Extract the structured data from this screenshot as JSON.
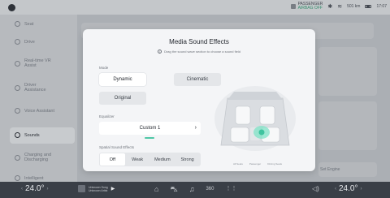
{
  "status": {
    "passenger_title": "PASSENGER",
    "passenger_sub": "AIRBAG OFF",
    "range": "501 km",
    "time": "17:07",
    "icons": [
      "bluetooth-icon",
      "wifi-icon",
      "battery-icon"
    ]
  },
  "sidebar": {
    "items": [
      {
        "label": "Seat",
        "icon": "seat-icon"
      },
      {
        "label": "Drive",
        "icon": "steering-icon"
      },
      {
        "label": "Real-time VR Assist",
        "icon": "vr-icon"
      },
      {
        "label": "Driver Assistance",
        "icon": "assist-icon"
      },
      {
        "label": "Voice Assistant",
        "icon": "voice-icon"
      },
      {
        "label": "Sounds",
        "icon": "sound-icon"
      },
      {
        "label": "Charging and Discharging",
        "icon": "charging-icon"
      },
      {
        "label": "Intelligent",
        "icon": "intelligent-icon"
      }
    ],
    "active_index": 5
  },
  "modal": {
    "title": "Media Sound Effects",
    "subtitle": "Drag the sound wave section to choose a sound field",
    "mode_label": "Mode",
    "modes": [
      "Dynamic",
      "Cinematic",
      "Original"
    ],
    "mode_selected": "Dynamic",
    "equalizer_label": "Equalizer",
    "equalizer_value": "Custom 1",
    "spatial_label": "Spatial Sound Effects",
    "spatial_options": [
      "Off",
      "Weak",
      "Medium",
      "Strong"
    ],
    "spatial_selected": "Off",
    "legend": [
      "All Seats",
      "Passenger",
      "Driving Seats"
    ]
  },
  "background": {
    "right_label": "Set Engine"
  },
  "bottom": {
    "temp_left": "24.0°",
    "temp_right": "24.0°",
    "music_title": "Unknown Song",
    "music_artist": "Unknown Artist",
    "dock": [
      "home-icon",
      "car-icon",
      "music-icon",
      "360-icon",
      "apps-icon"
    ],
    "dock_labels": [
      "⌂",
      "⛍",
      "♫",
      "360",
      "⋮⋮"
    ]
  },
  "colors": {
    "accent": "#4fc7a6",
    "modal_bg": "#f4f5f7",
    "bottom_bg": "#3a3f47"
  }
}
